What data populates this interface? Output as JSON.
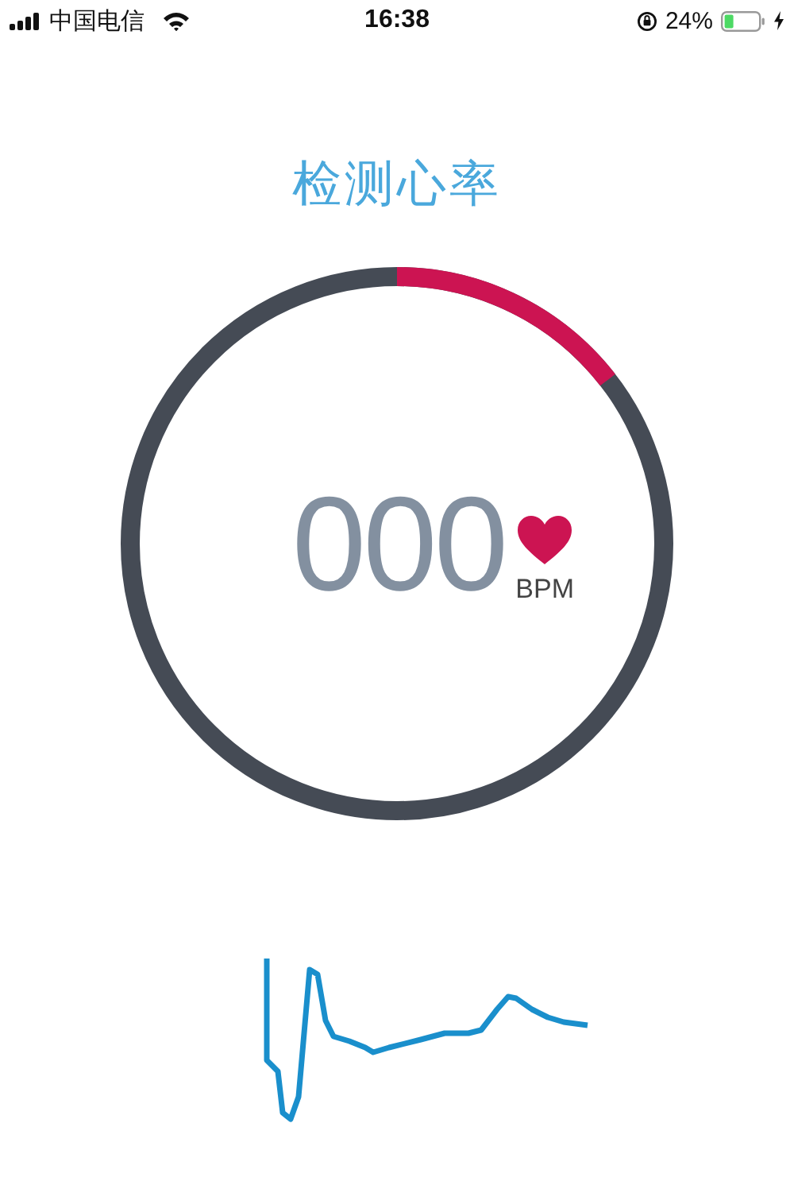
{
  "status_bar": {
    "carrier": "中国电信",
    "time": "16:38",
    "battery_percent": "24%"
  },
  "title": "检测心率",
  "heart_rate": {
    "value": "000",
    "unit": "BPM"
  }
}
